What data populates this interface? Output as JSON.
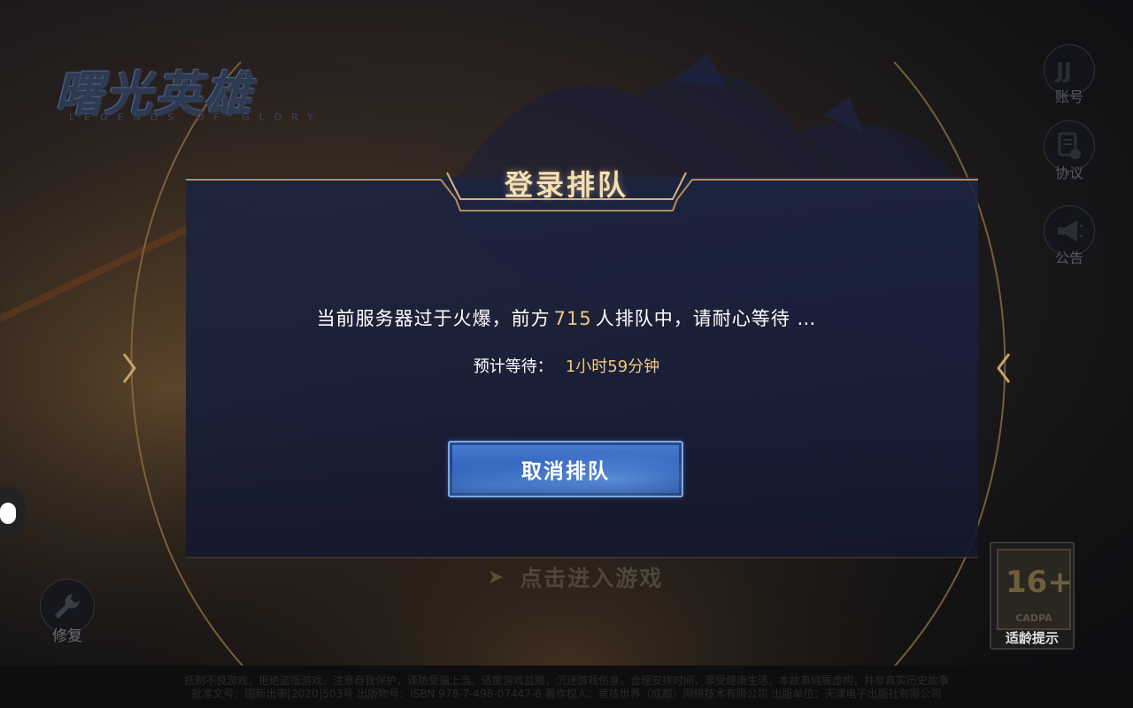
{
  "logo": {
    "title": "曙光英雄",
    "subtitle": "LEGENDS OF GLORY"
  },
  "side_buttons": [
    {
      "icon": "jj-logo-icon",
      "label": "账号"
    },
    {
      "icon": "document-check-icon",
      "label": "协议"
    },
    {
      "icon": "megaphone-icon",
      "label": "公告"
    }
  ],
  "dialog": {
    "title": "登录排队",
    "message_prefix": "当前服务器过于火爆，前方",
    "queue_count": "715",
    "message_suffix": "人排队中，请耐心等待 …",
    "eta_label": "预计等待：",
    "eta_value": "1小时59分钟",
    "cancel_label": "取消排队"
  },
  "enter_game": {
    "label": "点击进入游戏"
  },
  "repair": {
    "icon": "wrench-icon",
    "label": "修复"
  },
  "age_rating": {
    "number": "16+",
    "org": "CADPA",
    "tip": "适龄提示"
  },
  "notice": {
    "line1": "抵制不良游戏，拒绝盗版游戏。注意自我保护，谨防受骗上当。适度游戏益脑，沉迷游戏伤身。合理安排时间，享受健康生活。本故事纯属虚构，并非真实历史故事",
    "line2": "批准文号：国新出审[2020]503号  出版物号：ISBN 978-7-498-07447-8  著作权人：竞技世界（成都）网络技术有限公司  出版单位：天津电子出版社有限公司"
  },
  "colors": {
    "accent_gold": "#f3c77f",
    "title_gold": "#f5dfb4",
    "button_blue": "#3a6cc6"
  }
}
